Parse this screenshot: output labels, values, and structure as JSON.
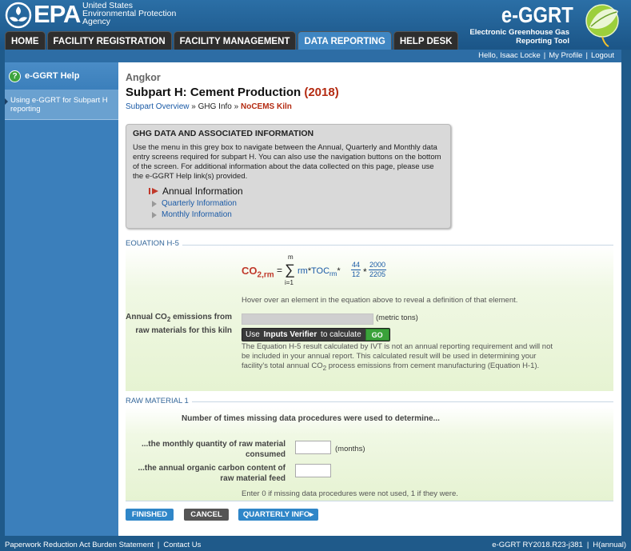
{
  "header": {
    "epa_text": "EPA",
    "agency_lines": [
      "United States",
      "Environmental Protection",
      "Agency"
    ],
    "app_title": "e-GGRT",
    "app_subtitle_lines": [
      "Electronic Greenhouse Gas",
      "Reporting Tool"
    ]
  },
  "nav": {
    "tabs": [
      {
        "label": "HOME"
      },
      {
        "label": "FACILITY REGISTRATION"
      },
      {
        "label": "FACILITY MANAGEMENT"
      },
      {
        "label": "DATA REPORTING"
      },
      {
        "label": "HELP DESK"
      }
    ],
    "active": "DATA REPORTING"
  },
  "userbar": {
    "greeting": "Hello, Isaac Locke",
    "my_profile": "My Profile",
    "logout": "Logout"
  },
  "sidebar": {
    "help_title": "e-GGRT Help",
    "help_link": "Using e-GGRT for Subpart H reporting"
  },
  "main": {
    "facility": "Angkor",
    "title": "Subpart H: Cement Production",
    "year": "(2018)",
    "breadcrumb": {
      "overview": "Subpart Overview",
      "sep1": " » ",
      "ghg_info": "GHG Info",
      "sep2": " » ",
      "current": "NoCEMS Kiln"
    },
    "ghg_box": {
      "heading": "GHG DATA AND ASSOCIATED INFORMATION",
      "body": "Use the menu in this grey box to navigate between the Annual, Quarterly and Monthly data entry screens required for subpart H. You can also use the navigation buttons on the bottom of the screen. For additional information about the data collected on this page, please use the e-GGRT Help link(s) provided.",
      "annual": "Annual Information",
      "quarterly": "Quarterly Information",
      "monthly": "Monthly Information"
    },
    "equation": {
      "section_label": "EQUATION H-5",
      "lhs": "CO",
      "lhs_sub2": "2",
      "lhs_sub": ",rm",
      "eq": "=",
      "sigma": "∑",
      "sigma_top": "m",
      "sigma_bottom": "i=1",
      "rm": "rm",
      "toc": "TOC",
      "toc_sub": "rm",
      "frac1_num": "44",
      "frac1_den": "12",
      "frac2_num": "2000",
      "frac2_den": "2205",
      "star": "*",
      "hover_note": "Hover over an element in the equation above to reveal a definition of that element.",
      "field_label_pre": "Annual CO",
      "field_label_sub": "2",
      "field_label_post": " emissions from raw materials for this kiln",
      "field_value": "",
      "unit": "(metric tons)",
      "verifier_pre": "Use",
      "verifier_bold": "Inputs Verifier",
      "verifier_post": "to calculate",
      "go": "GO",
      "ivt_note_pre": "The Equation H-5 result calculated by IVT is not an annual reporting requirement and will not be included in your annual report. This calculated result will be used in determining your facility's total annual CO",
      "ivt_note_sub": "2",
      "ivt_note_post": " process emissions from cement manufacturing (Equation H-1)."
    },
    "raw_material": {
      "section_label": "RAW MATERIAL 1",
      "heading": "Number of times missing data procedures were used to determine...",
      "q1_label": "...the monthly quantity of raw material consumed",
      "q1_value": "",
      "q1_unit": "(months)",
      "q2_label": "...the annual organic carbon content of raw material feed",
      "q2_value": "",
      "note": "Enter 0 if missing data procedures were not used, 1 if they were."
    },
    "buttons": {
      "finished": "FINISHED",
      "cancel": "CANCEL",
      "quarterly": "QUARTERLY INFO▸"
    }
  },
  "footer": {
    "paperwork": "Paperwork Reduction Act Burden Statement",
    "contact": "Contact Us",
    "version": "e-GGRT RY2018.R23-j381",
    "page_code": "H(annual)"
  },
  "colors": {
    "header_blue": "#2b6fa6",
    "active_tab": "#3f86c2",
    "accent_red": "#b42b12",
    "link_blue": "#1a5aa6",
    "go_green": "#3aa23a"
  }
}
